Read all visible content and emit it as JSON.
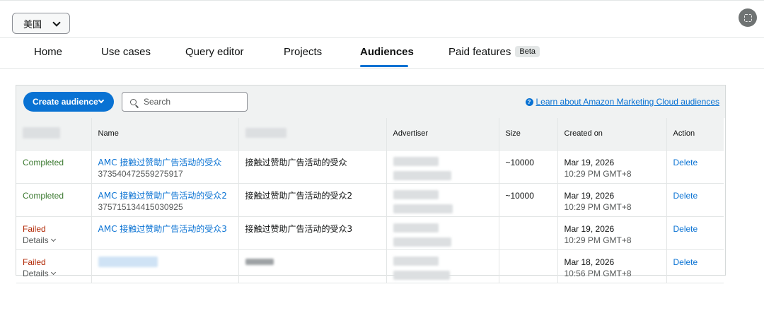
{
  "region": {
    "selected": "美国"
  },
  "tabs": [
    {
      "label": "Home"
    },
    {
      "label": "Use cases"
    },
    {
      "label": "Query editor"
    },
    {
      "label": "Projects"
    },
    {
      "label": "Audiences"
    },
    {
      "label": "Paid features",
      "badge": "Beta"
    }
  ],
  "active_tab": "Audiences",
  "toolbar": {
    "create_label": "Create audience",
    "search_placeholder": "Search",
    "learn_link": "Learn about Amazon Marketing Cloud audiences"
  },
  "table": {
    "columns": [
      "",
      "Name",
      "",
      "Advertiser",
      "Size",
      "Created on",
      "Action"
    ],
    "rows": [
      {
        "status": "Completed",
        "name": "AMC 接触过赞助广告活动的受众",
        "id": "373540472559275917",
        "description": "接触过赞助广告活动的受众",
        "size": "~10000",
        "date": "Mar 19, 2026",
        "time": "10:29 PM GMT+8",
        "action": "Delete"
      },
      {
        "status": "Completed",
        "name": "AMC 接触过赞助广告活动的受众2",
        "id": "375715134415030925",
        "description": "接触过赞助广告活动的受众2",
        "size": "~10000",
        "date": "Mar 19, 2026",
        "time": "10:29 PM GMT+8",
        "action": "Delete"
      },
      {
        "status": "Failed",
        "details": "Details",
        "name": "AMC 接触过赞助广告活动的受众3",
        "description": "接触过赞助广告活动的受众3",
        "size": "",
        "date": "Mar 19, 2026",
        "time": "10:29 PM GMT+8",
        "action": "Delete"
      },
      {
        "status": "Failed",
        "details": "Details",
        "name": "",
        "description": "",
        "size": "",
        "date": "Mar 18, 2026",
        "time": "10:56 PM GMT+8",
        "action": "Delete"
      }
    ]
  },
  "colors": {
    "accent": "#0972d3",
    "completed": "#3c7a31",
    "failed": "#b12704",
    "header_bg": "#f0f2f2"
  }
}
